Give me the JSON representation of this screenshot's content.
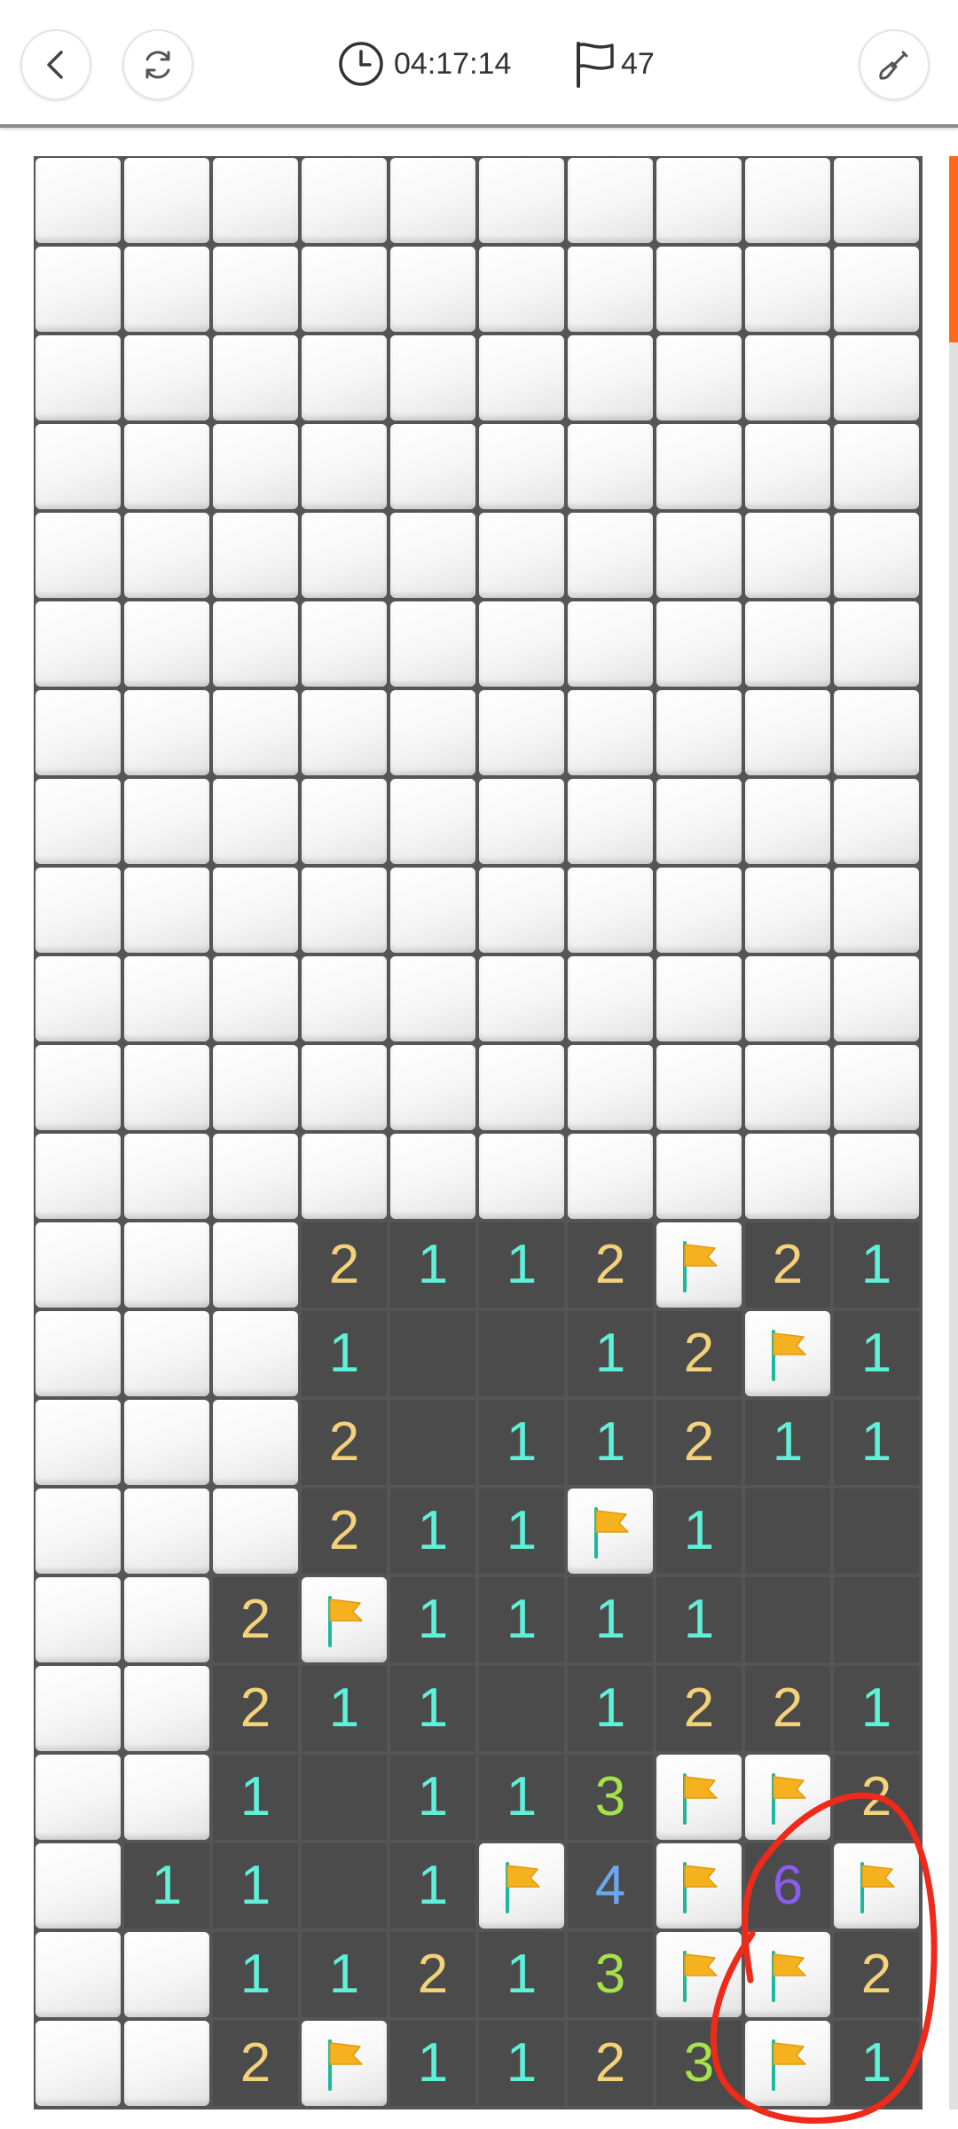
{
  "header": {
    "timer": "04:17:14",
    "flag_count": "47",
    "icons": {
      "back": "chevron-left-icon",
      "restart": "refresh-icon",
      "timer": "clock-icon",
      "flags": "flag-icon",
      "tool": "shovel-icon"
    }
  },
  "board": {
    "cols": 10,
    "rows": 22,
    "rows_data": [
      "##########",
      "##########",
      "##########",
      "##########",
      "##########",
      "##########",
      "##########",
      "##########",
      "##########",
      "##########",
      "##########",
      "##########",
      "###2112F21",
      "###1..12F1",
      "###2.11211",
      "###211F1..",
      "##2F1111..",
      "##211.1221",
      "##1.113FF2",
      "#11.1F4F6F",
      "##11213FF2",
      "##2F1123F1"
    ]
  },
  "colors": {
    "covered": "#f4f4f4",
    "open": "#4b4b4b",
    "grid": "#555555",
    "n1": "#5ff0d8",
    "n2": "#f4d27a",
    "n3": "#a6e34a",
    "n4": "#6aa8f0",
    "n6": "#8a5cf0",
    "flag": "#f6b11f",
    "flag_pole": "#1db89c",
    "annotation": "#ee2a1a",
    "scroll_thumb": "#ff6a1a"
  }
}
